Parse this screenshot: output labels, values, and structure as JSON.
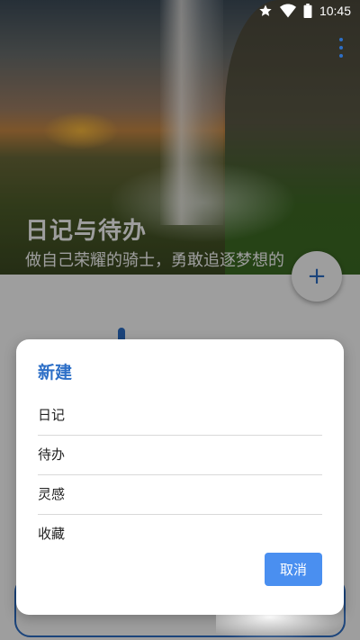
{
  "status_bar": {
    "time": "10:45",
    "icons": [
      "star-icon",
      "wifi-icon",
      "battery-icon"
    ]
  },
  "header": {
    "title": "日记与待办",
    "subtitle": "做自己荣耀的骑士，勇敢追逐梦想的",
    "menu_icon": "more-vert-icon"
  },
  "fab": {
    "icon": "plus-icon",
    "label": "+"
  },
  "dialog": {
    "title": "新建",
    "items": [
      {
        "label": "日记"
      },
      {
        "label": "待办"
      },
      {
        "label": "灵感"
      },
      {
        "label": "收藏"
      }
    ],
    "cancel_label": "取消"
  },
  "colors": {
    "accent": "#2d6fc7",
    "button": "#4a8ff0",
    "divider": "#d9d9d9"
  }
}
